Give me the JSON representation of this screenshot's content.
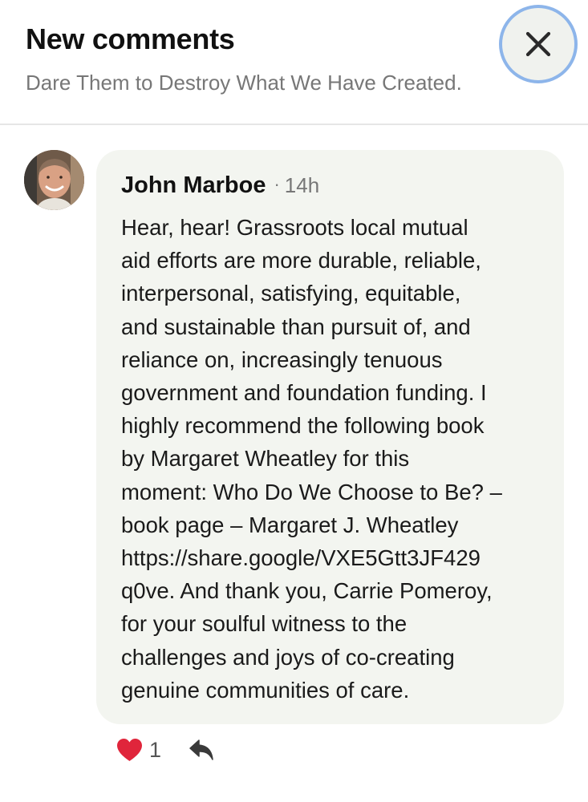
{
  "header": {
    "title": "New comments",
    "subtitle": "Dare Them to Destroy What We Have Created.",
    "close_icon": "close-icon"
  },
  "comment": {
    "author": "John Marboe",
    "separator": "·",
    "time": "14h",
    "avatar_icon": "user-avatar",
    "lines": [
      "Hear, hear! Grassroots local mutual",
      "aid efforts are more durable, reliable,",
      "interpersonal, satisfying, equitable,",
      "and sustainable than pursuit of, and",
      "reliance on, increasingly tenuous",
      "government and foundation funding. I",
      "highly recommend the following book",
      "by Margaret Wheatley for this",
      "moment: Who Do We Choose to Be? –",
      "book page – Margaret J. Wheatley",
      "https://share.google/VXE5Gtt3JF429",
      "q0ve. And thank you, Carrie Pomeroy,",
      "for your soulful witness to the",
      "challenges and joys of co-creating",
      "genuine communities of care."
    ],
    "like_count": "1",
    "like_icon": "heart-icon",
    "reply_icon": "reply-icon"
  },
  "colors": {
    "accent_heart": "#e0253b",
    "bubble_bg": "#f3f5f0",
    "focus_ring": "#8db5ea"
  }
}
